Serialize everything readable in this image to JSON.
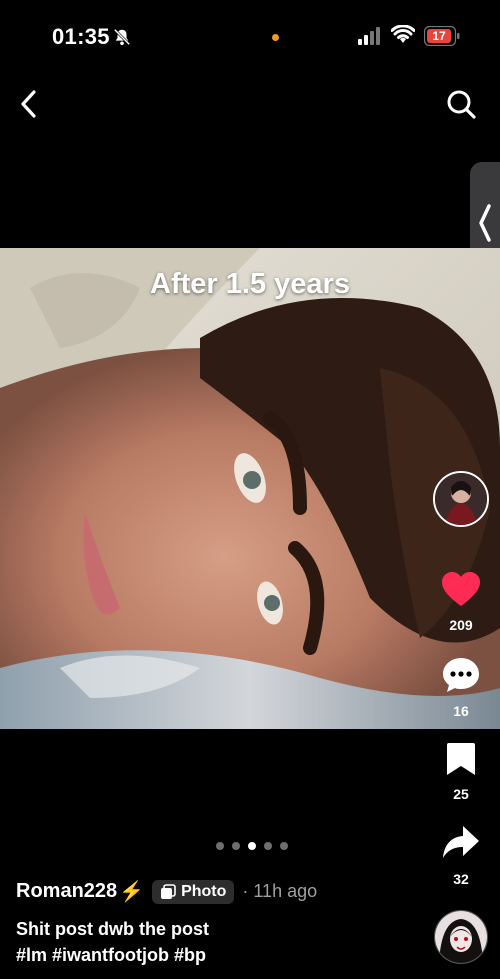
{
  "status_bar": {
    "time": "01:35",
    "battery": "17"
  },
  "post": {
    "caption": "After 1.5 years",
    "author": "Roman228",
    "badge": "Photo",
    "time_ago": "· 11h ago",
    "title": "Shit post dwb the post",
    "hashtags": "#lm #iwantfootjob #bp",
    "slide_count": 5,
    "active_slide": 3
  },
  "actions": {
    "likes": "209",
    "comments": "16",
    "saves": "25",
    "shares": "32"
  },
  "colors": {
    "like": "#fe2c55",
    "battery": "#e8453c",
    "accent_dot": "#f39a1c"
  },
  "icons": [
    "bell-off-icon",
    "signal-icon",
    "wifi-icon",
    "battery-icon",
    "back-icon",
    "search-icon",
    "chevron-left-icon",
    "heart-icon",
    "comment-icon",
    "bookmark-icon",
    "share-icon"
  ]
}
